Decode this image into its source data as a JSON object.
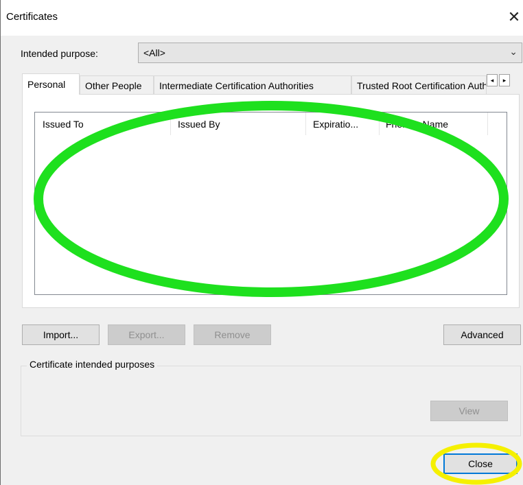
{
  "window": {
    "title": "Certificates",
    "close_glyph": "✕"
  },
  "purpose": {
    "label": "Intended purpose:",
    "value": "<All>"
  },
  "tabs": [
    {
      "label": "Personal"
    },
    {
      "label": "Other People"
    },
    {
      "label": "Intermediate Certification Authorities"
    },
    {
      "label": "Trusted Root Certification Authorities"
    }
  ],
  "tab_scroll": {
    "left": "◂",
    "right": "▸"
  },
  "list": {
    "columns": [
      "Issued To",
      "Issued By",
      "Expiratio...",
      "Friendly Name"
    ]
  },
  "buttons": {
    "import": "Import...",
    "export": "Export...",
    "remove": "Remove",
    "advanced": "Advanced",
    "view": "View",
    "close": "Close"
  },
  "group": {
    "label": "Certificate intended purposes"
  },
  "annotations": {
    "ellipse_color": "#1ee01e",
    "highlight_color": "#f5f000"
  }
}
